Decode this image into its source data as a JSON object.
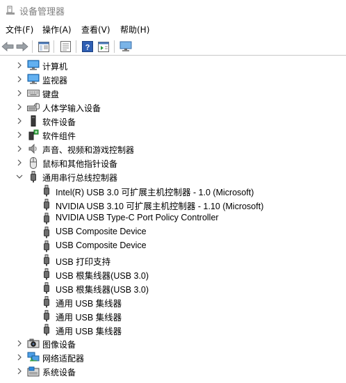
{
  "window": {
    "title": "设备管理器"
  },
  "menu": [
    {
      "label": "文件(F)"
    },
    {
      "label": "操作(A)"
    },
    {
      "label": "查看(V)"
    },
    {
      "label": "帮助(H)"
    }
  ],
  "toolbar": {
    "buttons": [
      {
        "icon": "back-arrow-icon"
      },
      {
        "icon": "forward-arrow-icon"
      },
      {
        "icon": "show-hide-console-tree-icon"
      },
      {
        "icon": "properties-icon"
      },
      {
        "icon": "help-icon"
      },
      {
        "icon": "action-pane-icon"
      },
      {
        "icon": "monitor-scan-icon"
      }
    ]
  },
  "tree": {
    "categories_before": [
      {
        "label": "计算机",
        "icon": "computer-icon"
      },
      {
        "label": "监视器",
        "icon": "monitor-icon"
      },
      {
        "label": "键盘",
        "icon": "keyboard-icon"
      },
      {
        "label": "人体学输入设备",
        "icon": "hid-icon"
      },
      {
        "label": "软件设备",
        "icon": "software-device-icon"
      },
      {
        "label": "软件组件",
        "icon": "software-component-icon"
      },
      {
        "label": "声音、视频和游戏控制器",
        "icon": "speaker-icon"
      },
      {
        "label": "鼠标和其他指针设备",
        "icon": "mouse-icon"
      }
    ],
    "expanded": {
      "label": "通用串行总线控制器",
      "icon": "usb-plug-icon",
      "children": [
        "Intel(R) USB 3.0 可扩展主机控制器 - 1.0 (Microsoft)",
        "NVIDIA USB 3.10 可扩展主机控制器 - 1.10 (Microsoft)",
        "NVIDIA USB Type-C Port Policy Controller",
        "USB Composite Device",
        "USB Composite Device",
        "USB 打印支持",
        "USB 根集线器(USB 3.0)",
        "USB 根集线器(USB 3.0)",
        "通用 USB 集线器",
        "通用 USB 集线器",
        "通用 USB 集线器"
      ]
    },
    "categories_after": [
      {
        "label": "图像设备",
        "icon": "camera-icon"
      },
      {
        "label": "网络适配器",
        "icon": "network-adapter-icon"
      },
      {
        "label": "系统设备",
        "icon": "system-device-icon"
      }
    ]
  },
  "colors": {
    "chevron": "#555555",
    "monitor_blue": "#1e7fd8",
    "usb_gray": "#6e6e6e",
    "separator": "#c8c8c8"
  }
}
